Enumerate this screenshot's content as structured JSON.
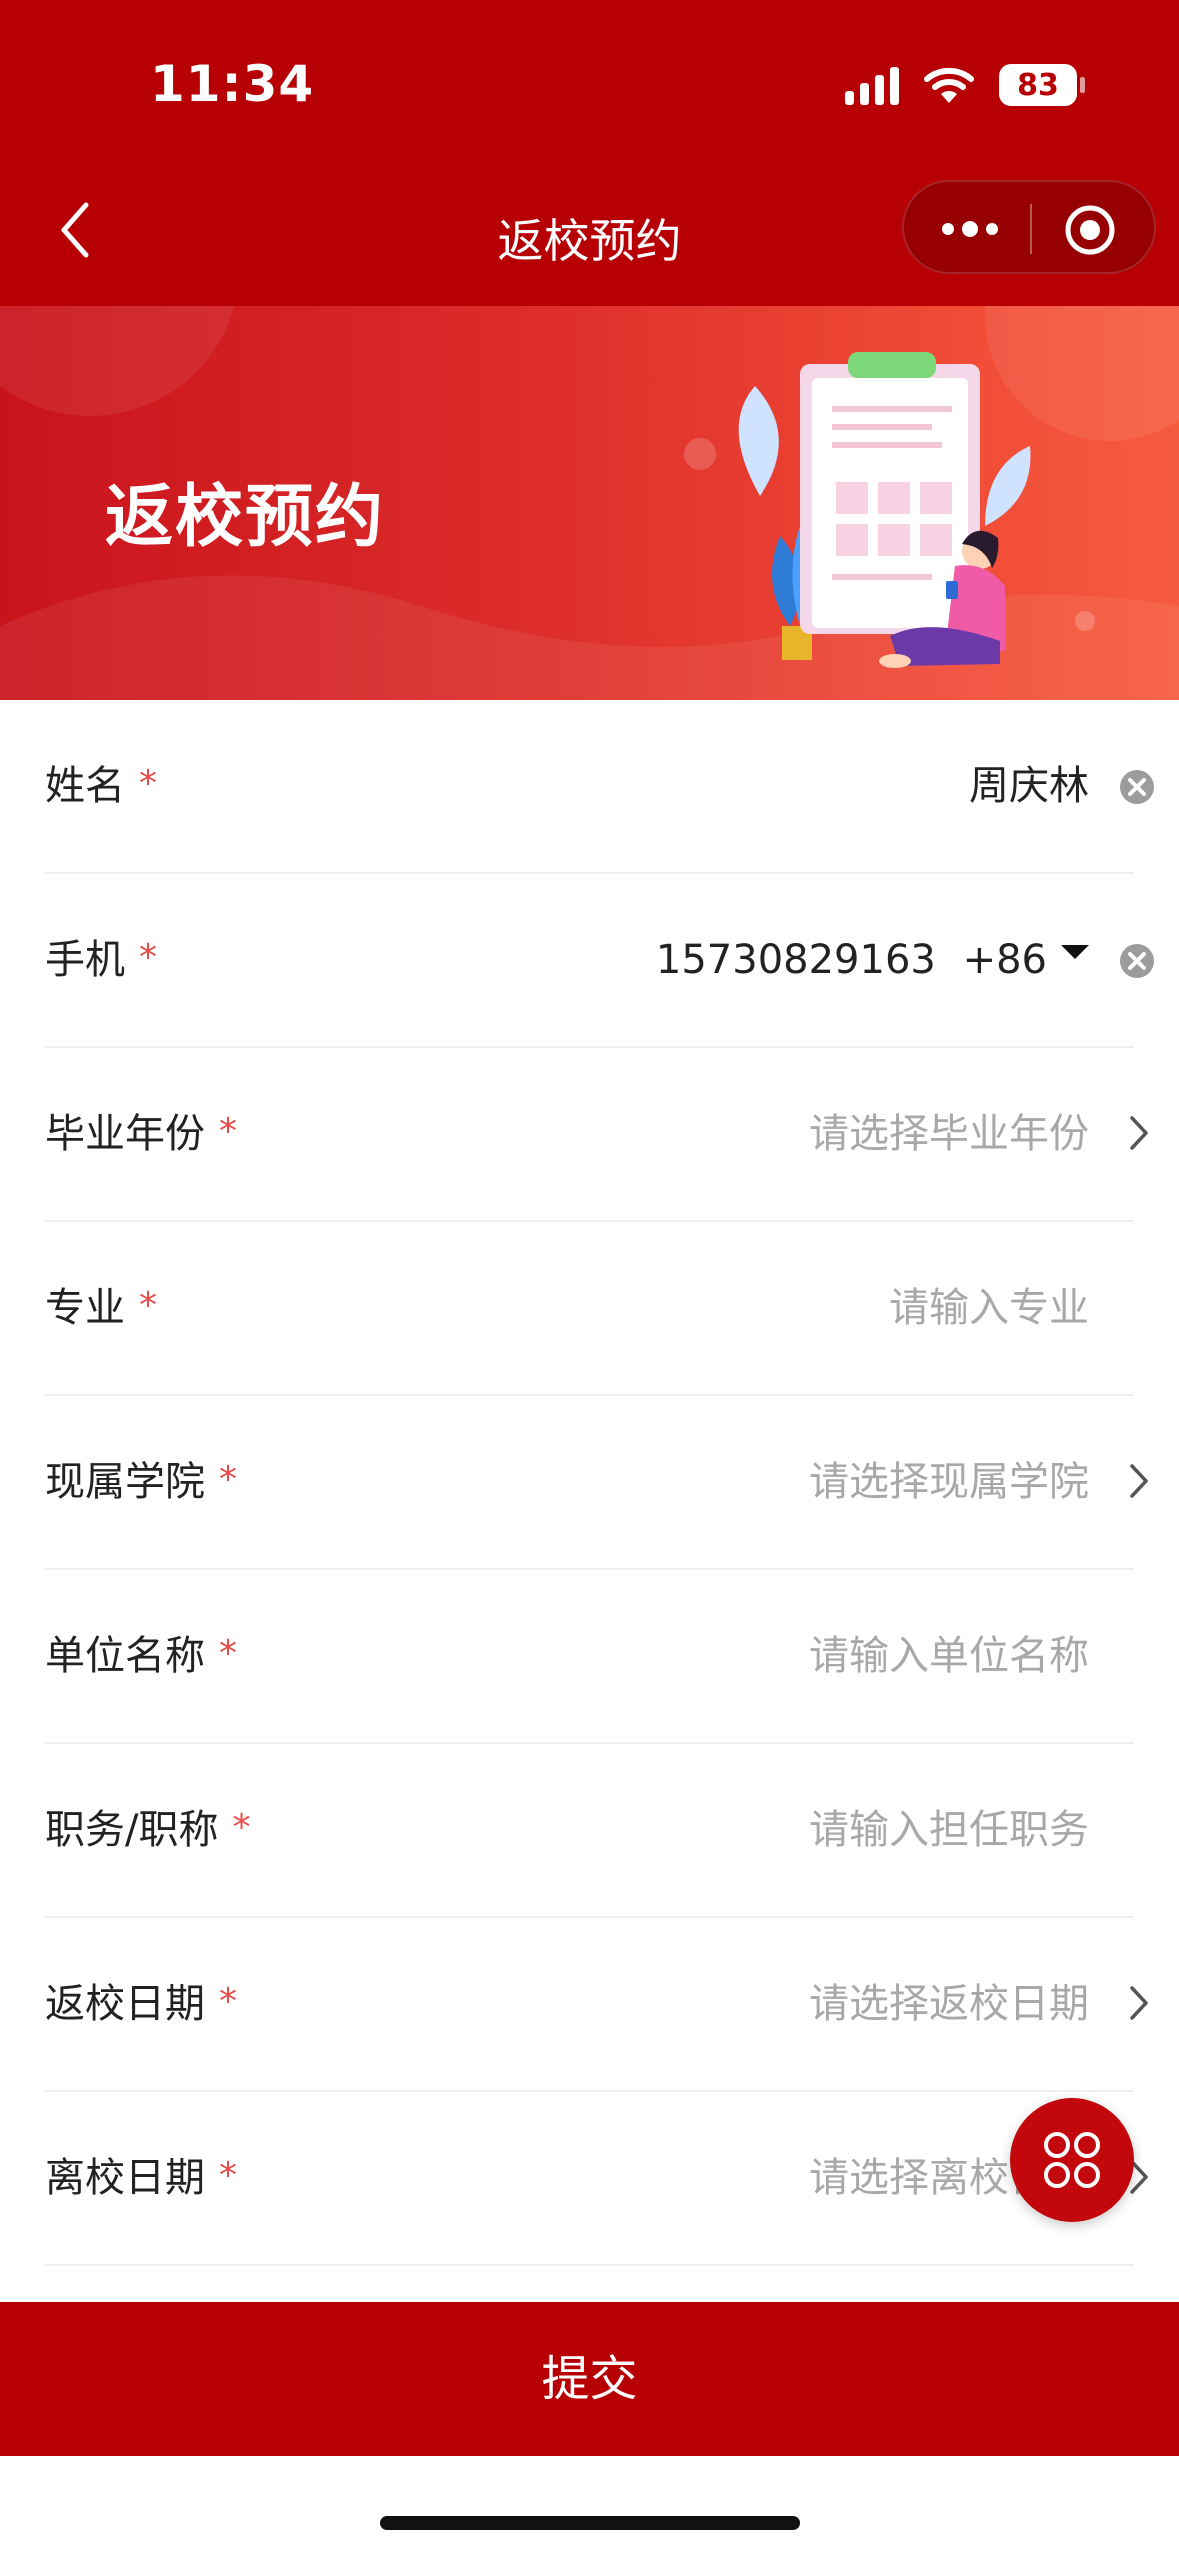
{
  "status_bar": {
    "time": "11:34",
    "battery": "83"
  },
  "nav": {
    "title": "返校预约"
  },
  "banner": {
    "title": "返校预约"
  },
  "form": {
    "fields": [
      {
        "label": "姓名",
        "required": "*",
        "value": "周庆林",
        "placeholder": ""
      },
      {
        "label": "手机",
        "required": "*",
        "value": "15730829163",
        "country_code": "+86"
      },
      {
        "label": "毕业年份",
        "required": "*",
        "placeholder": "请选择毕业年份"
      },
      {
        "label": "专业",
        "required": "*",
        "placeholder": "请输入专业"
      },
      {
        "label": "现属学院",
        "required": "*",
        "placeholder": "请选择现属学院"
      },
      {
        "label": "单位名称",
        "required": "*",
        "placeholder": "请输入单位名称"
      },
      {
        "label": "职务/职称",
        "required": "*",
        "placeholder": "请输入担任职务"
      },
      {
        "label": "返校日期",
        "required": "*",
        "placeholder": "请选择返校日期"
      },
      {
        "label": "离校日期",
        "required": "*",
        "placeholder": "请选择离校日期"
      }
    ]
  },
  "submit": {
    "label": "提交"
  },
  "colors": {
    "primary": "#b70004",
    "required": "#e94b4b",
    "placeholder": "#a8a8a8"
  },
  "icons": [
    "back-icon",
    "more-icon",
    "target-icon",
    "clear-icon",
    "chevron-right-icon",
    "clover-icon"
  ]
}
